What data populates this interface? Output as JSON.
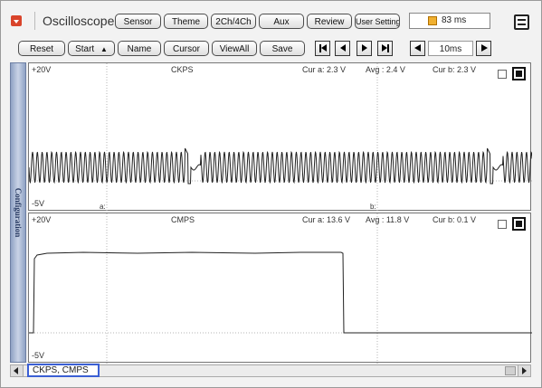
{
  "app": {
    "title": "Oscilloscope"
  },
  "toolbar1": {
    "sensor": "Sensor",
    "theme": "Theme",
    "channels": "2Ch/4Ch",
    "aux": "Aux",
    "review": "Review",
    "user_setting": "User Setting",
    "refresh": "83 ms"
  },
  "toolbar2": {
    "reset": "Reset",
    "start": "Start",
    "name": "Name",
    "cursor": "Cursor",
    "viewall": "ViewAll",
    "save": "Save",
    "timebase": "10ms"
  },
  "sidebar": {
    "label": "Configuration"
  },
  "channel1": {
    "max": "+20V",
    "min": "-5V",
    "name": "CKPS",
    "cur_a": "Cur a: 2.3 V",
    "avg": "Avg : 2.4 V",
    "cur_b": "Cur b: 2.3 V",
    "cursor_a": "a:",
    "cursor_b": "b:"
  },
  "channel2": {
    "max": "+20V",
    "min": "-5V",
    "name": "CMPS",
    "cur_a": "Cur a: 13.6 V",
    "avg": "Avg : 11.8 V",
    "cur_b": "Cur b: 0.1 V"
  },
  "status": {
    "channels": "CKPS, CMPS"
  }
}
